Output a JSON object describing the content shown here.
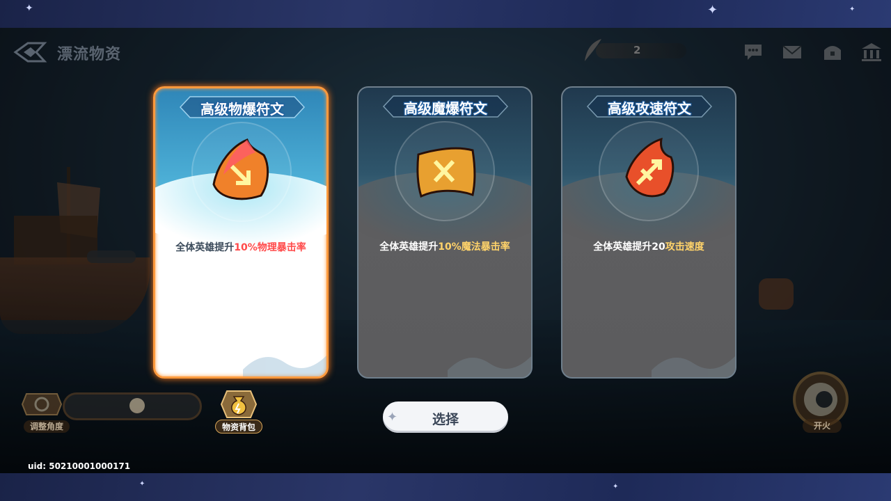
{
  "header": {
    "title": "漂流物资",
    "counter_value": "2",
    "icons": [
      "chat-icon",
      "mail-icon",
      "chest-icon",
      "bank-icon"
    ]
  },
  "cards": [
    {
      "name": "高级物爆符文",
      "desc_prefix": "全体英雄提升",
      "desc_highlight": "10%物理暴击率",
      "highlight_color": "#ff4a4a",
      "selected": true,
      "icon": "phys-crit-rune-icon"
    },
    {
      "name": "高级魔爆符文",
      "desc_prefix": "全体英雄提升",
      "desc_highlight": "10%魔法暴击率",
      "highlight_color": "#ffd36a",
      "selected": false,
      "icon": "magic-crit-rune-icon"
    },
    {
      "name": "高级攻速符文",
      "desc_prefix": "全体英雄提升20",
      "desc_highlight": "攻击速度",
      "highlight_color": "#ffd36a",
      "selected": false,
      "icon": "attack-speed-rune-icon"
    }
  ],
  "controls": {
    "angle_label": "调整角度",
    "bag_label": "物资背包",
    "select_label": "选择",
    "fire_label": "开火"
  },
  "footer": {
    "uid": "uid: 50210001000171"
  },
  "colors": {
    "selected_border": "#ff9a3d",
    "banner_outline": "#1e5c9e"
  }
}
